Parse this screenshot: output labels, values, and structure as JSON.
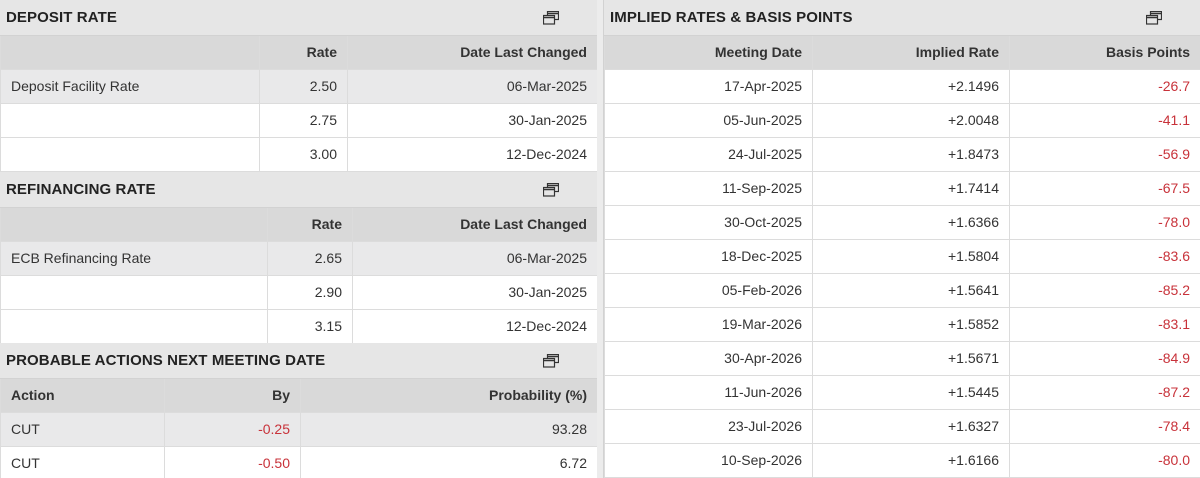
{
  "deposit": {
    "title": "DEPOSIT RATE",
    "headers": [
      "",
      "Rate",
      "Date Last Changed"
    ],
    "rows": [
      {
        "name": "Deposit Facility Rate",
        "rate": "2.50",
        "date": "06-Mar-2025"
      },
      {
        "name": "",
        "rate": "2.75",
        "date": "30-Jan-2025"
      },
      {
        "name": "",
        "rate": "3.00",
        "date": "12-Dec-2024"
      }
    ]
  },
  "refi": {
    "title": "REFINANCING RATE",
    "headers": [
      "",
      "Rate",
      "Date Last Changed"
    ],
    "rows": [
      {
        "name": "ECB Refinancing Rate",
        "rate": "2.65",
        "date": "06-Mar-2025"
      },
      {
        "name": "",
        "rate": "2.90",
        "date": "30-Jan-2025"
      },
      {
        "name": "",
        "rate": "3.15",
        "date": "12-Dec-2024"
      }
    ]
  },
  "probable": {
    "title": "PROBABLE ACTIONS NEXT MEETING DATE",
    "headers": [
      "Action",
      "By",
      "Probability (%)"
    ],
    "rows": [
      {
        "action": "CUT",
        "by": "-0.25",
        "prob": "93.28"
      },
      {
        "action": "CUT",
        "by": "-0.50",
        "prob": "6.72"
      }
    ]
  },
  "implied": {
    "title": "IMPLIED RATES & BASIS POINTS",
    "headers": [
      "Meeting Date",
      "Implied Rate",
      "Basis Points"
    ],
    "rows": [
      {
        "date": "17-Apr-2025",
        "rate": "+2.1496",
        "bp": "-26.7"
      },
      {
        "date": "05-Jun-2025",
        "rate": "+2.0048",
        "bp": "-41.1"
      },
      {
        "date": "24-Jul-2025",
        "rate": "+1.8473",
        "bp": "-56.9"
      },
      {
        "date": "11-Sep-2025",
        "rate": "+1.7414",
        "bp": "-67.5"
      },
      {
        "date": "30-Oct-2025",
        "rate": "+1.6366",
        "bp": "-78.0"
      },
      {
        "date": "18-Dec-2025",
        "rate": "+1.5804",
        "bp": "-83.6"
      },
      {
        "date": "05-Feb-2026",
        "rate": "+1.5641",
        "bp": "-85.2"
      },
      {
        "date": "19-Mar-2026",
        "rate": "+1.5852",
        "bp": "-83.1"
      },
      {
        "date": "30-Apr-2026",
        "rate": "+1.5671",
        "bp": "-84.9"
      },
      {
        "date": "11-Jun-2026",
        "rate": "+1.5445",
        "bp": "-87.2"
      },
      {
        "date": "23-Jul-2026",
        "rate": "+1.6327",
        "bp": "-78.4"
      },
      {
        "date": "10-Sep-2026",
        "rate": "+1.6166",
        "bp": "-80.0"
      }
    ]
  },
  "icons": {
    "popout": "popout-window-icon"
  },
  "colors": {
    "negative": "#c8323a",
    "header_bg": "#e6e6e6",
    "col_header_bg": "#d9d9d9",
    "highlight_row": "#e9e9ea"
  }
}
